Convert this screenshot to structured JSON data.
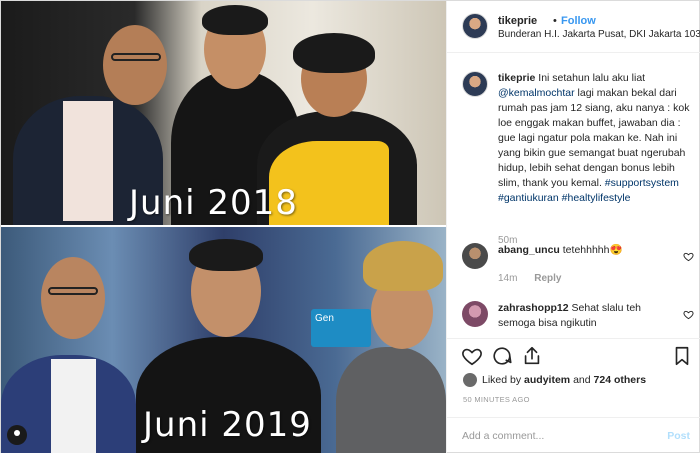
{
  "photo": {
    "top_caption": "Juni 2018",
    "bottom_caption": "Juni 2019",
    "sign_text": "Gen"
  },
  "header": {
    "username": "tikeprie",
    "separator": "•",
    "follow_label": "Follow",
    "location": "Bunderan H.I. Jakarta Pusat, DKI Jakarta 10310..."
  },
  "caption": {
    "username": "tikeprie",
    "text_part1": "Ini setahun lalu aku liat",
    "mention": "@kemalmochtar",
    "text_part2": "lagi makan bekal dari rumah pas jam 12 siang, aku nanya : kok loe enggak makan buffet, jawaban dia : gue lagi ngatur pola makan ke. Nah ini yang bikin gue semangat buat ngerubah hidup, lebih sehat dengan bonus lebih slim, thank you kemal.",
    "tags": [
      "#supportsystem",
      "#gantiukuran",
      "#healtylifestyle"
    ],
    "age": "50m"
  },
  "comments": [
    {
      "username": "abang_uncu",
      "text": "tetehhhhh😍",
      "age": "14m",
      "reply_label": "Reply"
    },
    {
      "username": "zahrashopp12",
      "text": "Sehat slalu teh semoga bisa ngikutin",
      "age": "",
      "reply_label": ""
    }
  ],
  "actions": {
    "liked_prefix": "Liked by",
    "liked_user": "audyitem",
    "liked_mid": "and",
    "liked_count": "724 others",
    "timestamp": "50 MINUTES AGO"
  },
  "add_comment": {
    "placeholder": "Add a comment...",
    "post_label": "Post"
  },
  "colors": {
    "link": "#3897f0",
    "hashtag": "#003569",
    "muted": "#999999",
    "border": "#efefef"
  },
  "icons": [
    "heart-icon",
    "comment-icon",
    "share-icon",
    "bookmark-icon",
    "small-heart-icon"
  ]
}
